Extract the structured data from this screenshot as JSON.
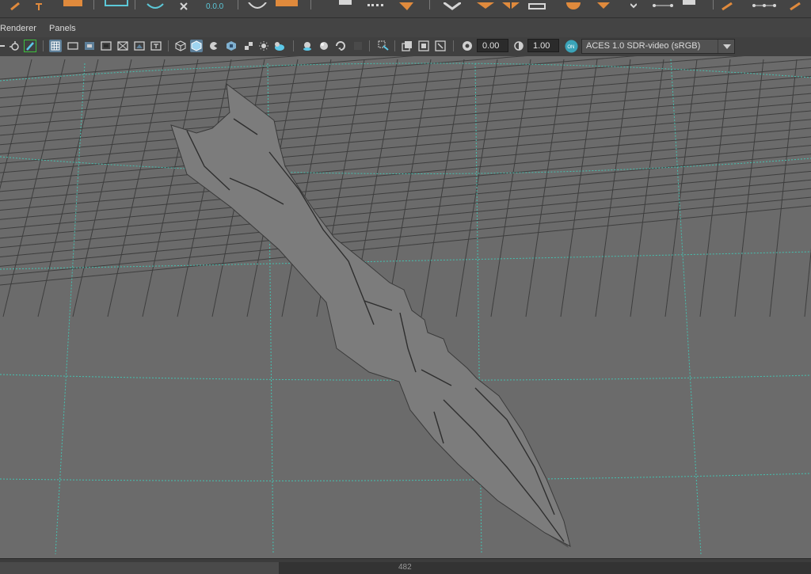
{
  "menubar": {
    "items": [
      "Renderer",
      "Panels"
    ]
  },
  "toolbar": {
    "exposure_value": "0.00",
    "gamma_value": "1.00",
    "color_space": "ACES 1.0 SDR-video (sRGB)",
    "icons": [
      "camera-icon",
      "snapshot-icon",
      "pencil-icon",
      "grid-icon",
      "film-gate-icon",
      "resolution-gate-icon",
      "gate-mask-icon",
      "field-chart-icon",
      "safe-action-icon",
      "safe-title-icon",
      "wireframe-icon",
      "smooth-shade-icon",
      "wireframe-on-shaded-icon",
      "textured-icon",
      "use-all-lights-icon",
      "shadows-icon",
      "ambient-occlusion-icon",
      "motion-blur-icon",
      "anti-alias-icon",
      "depth-of-field-icon",
      "isolate-select-icon",
      "xray-icon",
      "xray-joints-icon",
      "xray-active-icon",
      "backface-culling-icon",
      "exposure-icon",
      "gamma-icon",
      "color-management-icon"
    ]
  },
  "timeline": {
    "frame": "482"
  },
  "colors": {
    "viewport_bg": "#6b6b6b",
    "grid_line": "#3e3e3e",
    "axis_line": "#46c0b0",
    "model_face": "#7c7c7c",
    "model_side": "#505050",
    "accent_orange": "#e08a3c",
    "accent_blue": "#5d7f99"
  }
}
